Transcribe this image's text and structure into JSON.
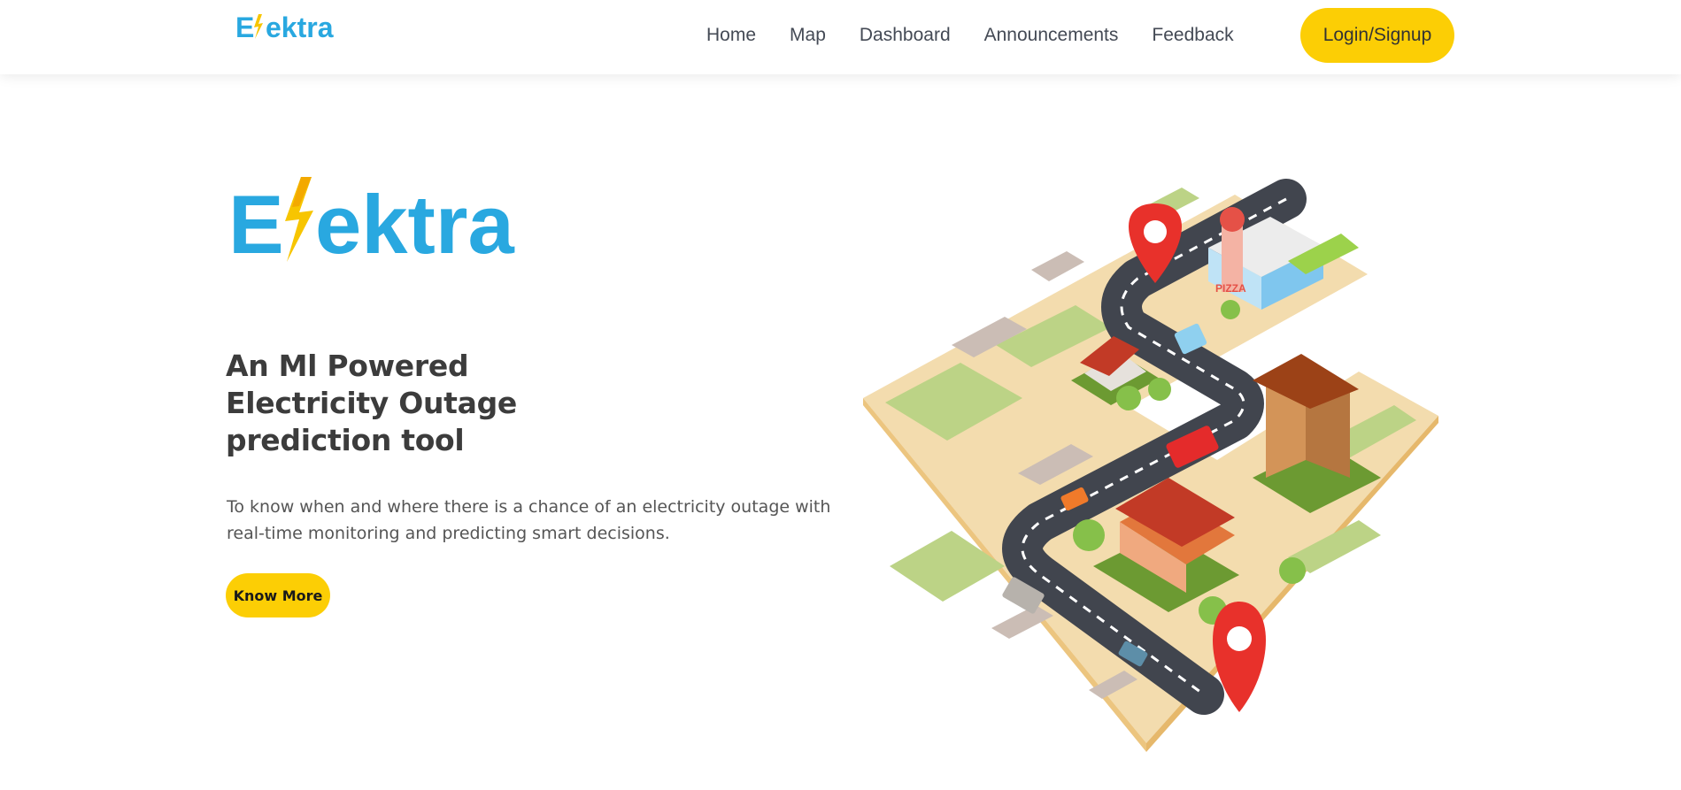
{
  "brand": {
    "logo_text": "Elektra",
    "colors": {
      "primary_blue": "#29a8e0",
      "accent_yellow": "#fcce05",
      "bolt_yellow": "#f7c500"
    }
  },
  "nav": {
    "links": [
      "Home",
      "Map",
      "Dashboard",
      "Announcements",
      "Feedback"
    ],
    "login_label": "Login/Signup"
  },
  "hero": {
    "headline": [
      "An Ml Powered",
      "Electricity Outage",
      "prediction tool"
    ],
    "subtext": "To know when and where there is a chance of an electricity outage with real-time monitoring and predicting smart decisions.",
    "cta_label": "Know More"
  },
  "illustration": {
    "icon": "isometric-city-map-illustration",
    "sign_text": "PIZZA"
  }
}
